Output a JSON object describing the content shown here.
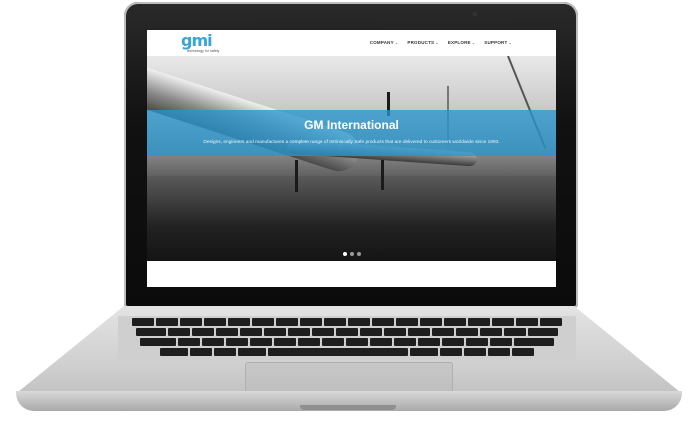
{
  "header": {
    "logo_text": "gmi",
    "logo_tagline": "technology for safety",
    "nav": [
      {
        "label": "COMPANY"
      },
      {
        "label": "PRODUCTS"
      },
      {
        "label": "EXPLORE"
      },
      {
        "label": "SUPPORT"
      }
    ]
  },
  "hero": {
    "title": "GM International",
    "subtitle": "Designs, engineers and manufactures a complete range of Intrinsically Safe products that are delivered to customers worldwide since 1993.",
    "slides": 3,
    "active_slide": 1
  },
  "colors": {
    "brand_blue": "#3aa3d8",
    "banner": "#2896cd"
  }
}
